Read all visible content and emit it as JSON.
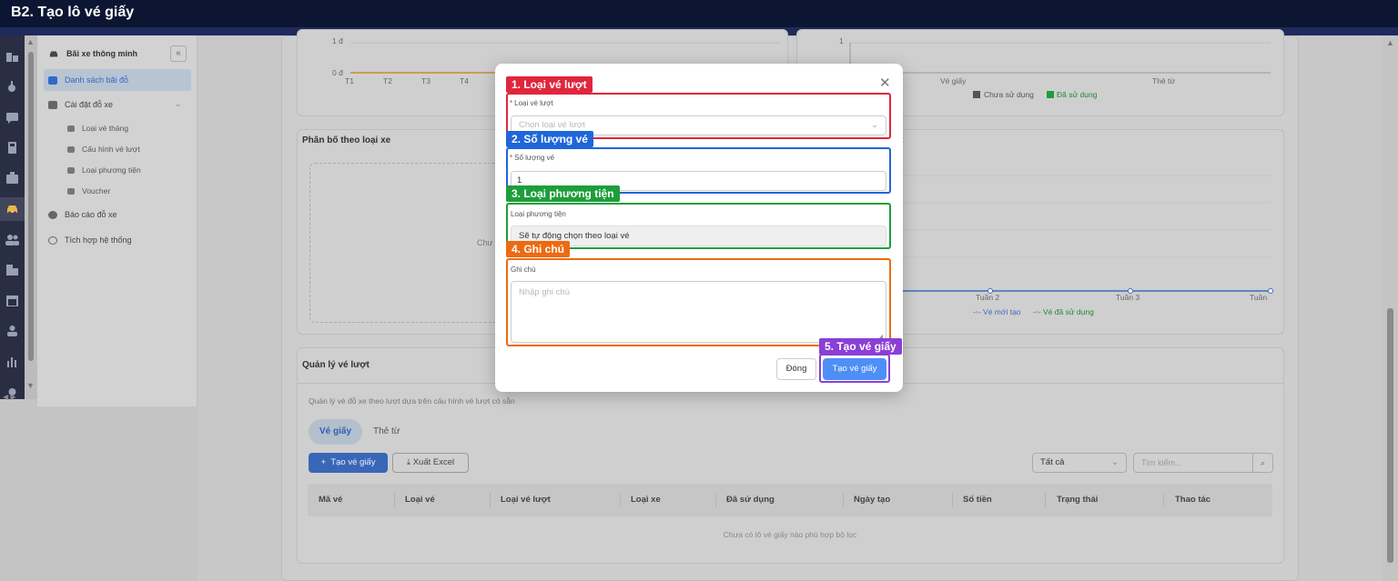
{
  "header": {
    "title": "B2. Tạo lô vé giấy"
  },
  "sidebar": {
    "items": [
      {
        "label": "Bãi xe thông minh"
      },
      {
        "label": "Danh sách bãi đỗ"
      },
      {
        "label": "Cài đặt đỗ xe"
      },
      {
        "label": "Loại vé tháng"
      },
      {
        "label": "Cấu hình vé lượt"
      },
      {
        "label": "Loại phương tiện"
      },
      {
        "label": "Voucher"
      },
      {
        "label": "Báo cáo đỗ xe"
      },
      {
        "label": "Tích hợp hệ thống"
      }
    ]
  },
  "background": {
    "chart_left": {
      "ytick_top": "1 đ",
      "ytick_bottom": "0 đ",
      "xticks": [
        "T1",
        "T2",
        "T3",
        "T4"
      ]
    },
    "chart_right": {
      "ytick": "1",
      "xticks": [
        "Vé giấy",
        "Thẻ từ"
      ],
      "legend": [
        "Chưa sử dụng",
        "Đã sử dụng"
      ]
    },
    "card_distribution_title": "Phân bố theo loại xe",
    "chart_line": {
      "xticks": [
        "Tuần 2",
        "Tuần 3",
        "Tuần"
      ],
      "legend": [
        "Vé mới tạo",
        "Vé đã sử dụng"
      ]
    },
    "partial_text": "Chư",
    "partial_t": "t"
  },
  "ticket_mgmt": {
    "title": "Quản lý vé lượt",
    "description": "Quản lý vé đỗ xe theo lượt dựa trên cấu hình vé lượt có sẵn",
    "tabs": [
      "Vé giấy",
      "Thẻ từ"
    ],
    "create_button": "Tạo vé giấy",
    "export_button": "Xuất Excel",
    "filter_value": "Tất cả",
    "search_placeholder": "Tìm kiếm...",
    "columns": [
      "Mã vé",
      "Loại vé",
      "Loại vé lượt",
      "Loại xe",
      "Đã sử dụng",
      "Ngày tạo",
      "Số tiền",
      "Trạng thái",
      "Thao tác"
    ],
    "empty_text": "Chưa có lô vé giấy nào phù hợp bộ lọc"
  },
  "modal": {
    "annotations": [
      "1. Loại vé lượt",
      "2. Số lượng vé",
      "3. Loại phương tiện",
      "4. Ghi chú",
      "5. Tạo vé giấy"
    ],
    "ticket_type_label": "Loại vé lượt",
    "ticket_type_placeholder": "Chọn loại vé lượt",
    "quantity_label": "Số lượng vé",
    "quantity_value": "1",
    "vehicle_label": "Loại phương tiện",
    "vehicle_value": "Sẽ tự động chọn theo loại vé",
    "note_label": "Ghi chú",
    "note_placeholder": "Nhập ghi chú",
    "cancel_button": "Đóng",
    "submit_button": "Tạo vé giấy"
  },
  "colors": {
    "anno1": "#e0263d",
    "anno2": "#1f66d9",
    "anno3": "#1d9e3a",
    "anno4": "#ee6a12",
    "anno5": "#8a3fd6",
    "primary": "#4e8ff7"
  }
}
